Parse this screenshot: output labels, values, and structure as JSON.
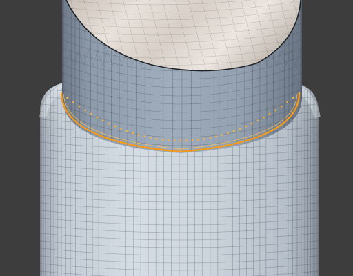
{
  "viewport": {
    "background_color": "#3d3d3d",
    "view": "3d-viewport-edit-mode"
  },
  "mesh": {
    "upper_tube_color": "#8f9db0",
    "inner_surface_color": "#e2dbd4",
    "base_cylinder_color": "#c4cdd6",
    "wire_color": "#2b2f36",
    "selected_edge_loop_color": "#f19a1c",
    "selected_vertex_color": "#ffb03a"
  }
}
